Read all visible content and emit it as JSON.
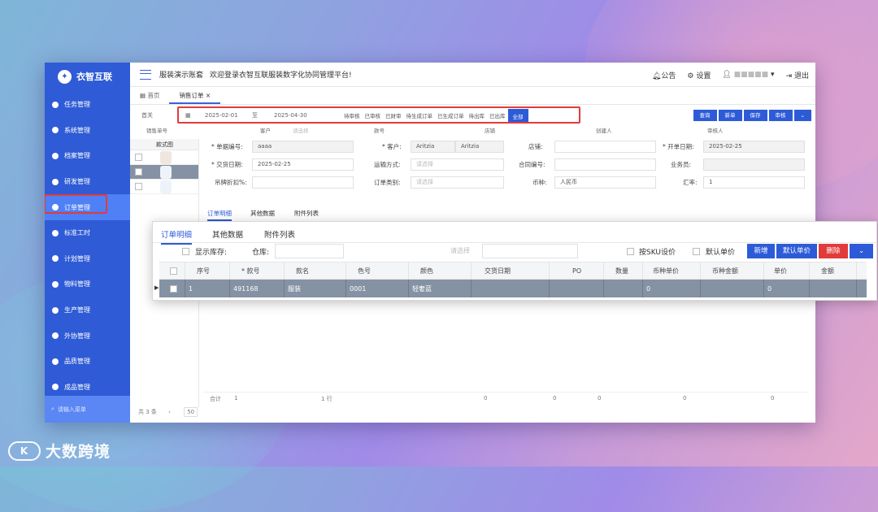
{
  "app": {
    "brand": "衣智互联",
    "company": "服装演示账套",
    "welcome": "欢迎登录衣智互联服装数字化协同管理平台!",
    "notice": "公告",
    "settings": "设置",
    "user": "■■■■■",
    "logout": "退出"
  },
  "sidebar": {
    "items": [
      {
        "label": "任务管理"
      },
      {
        "label": "系统管理"
      },
      {
        "label": "档案管理"
      },
      {
        "label": "研发管理"
      },
      {
        "label": "订单管理"
      },
      {
        "label": "标准工时"
      },
      {
        "label": "计划管理"
      },
      {
        "label": "物料管理"
      },
      {
        "label": "生产管理"
      },
      {
        "label": "外协管理"
      },
      {
        "label": "品质管理"
      },
      {
        "label": "成品管理"
      }
    ],
    "search_placeholder": "请输入菜单"
  },
  "tabs": {
    "home": "首页",
    "sales_order": "销售订单",
    "close": "×"
  },
  "filter": {
    "first": "首关",
    "date_from": "2025-02-01",
    "to": "至",
    "date_to": "2025-04-30",
    "status": [
      "待审核",
      "已审核",
      "已财审",
      "待生成订单",
      "已生成订单",
      "待出库",
      "已出库",
      "全部"
    ],
    "actions": [
      "查询",
      "新单",
      "保存",
      "审核"
    ],
    "row2": [
      "销售单号",
      "客户",
      "请选择",
      "款号",
      "店铺",
      "创建人",
      "审核人"
    ]
  },
  "left_grid": {
    "header": "款式图"
  },
  "form": {
    "order_no_label": "* 单据编号:",
    "order_no": "aaaa",
    "customer_label": "* 客户:",
    "customer_code": "Aritzia",
    "customer_name": "Aritzia",
    "shop_label": "店铺:",
    "open_date_label": "* 开单日期:",
    "open_date": "2025-02-25",
    "delivery_label": "* 交货日期:",
    "delivery_date": "2025-02-25",
    "transport_label": "运输方式:",
    "transport_ph": "请选择",
    "contract_label": "合同编号:",
    "sales_label": "业务员:",
    "discount_label": "吊牌折扣%:",
    "order_type_label": "订单类别:",
    "order_type_ph": "请选择",
    "currency_label": "币种:",
    "currency": "人民币",
    "rate_label": "汇率:",
    "rate": "1"
  },
  "subtabs": [
    "订单明细",
    "其他数据",
    "附件列表"
  ],
  "footer": {
    "total_label": "合计",
    "total_qty": "1",
    "rows": "1 行",
    "zeros": [
      "0",
      "0",
      "0",
      "0",
      "0"
    ],
    "pager": "共 3 条",
    "page_size": "50"
  },
  "overlay": {
    "tabs": [
      "订单明细",
      "其他数据",
      "附件列表"
    ],
    "show_stock": "显示库存:",
    "warehouse": "仓库:",
    "select_ph": "请选择",
    "sku_price": "按SKU设价",
    "default_price": "默认单价",
    "btn_new": "新增",
    "btn_default": "默认单价",
    "btn_delete": "删除",
    "columns": [
      "序号",
      "* 款号",
      "款名",
      "色号",
      "颜色",
      "交货日期",
      "PO",
      "数量",
      "币种单价",
      "币种金额",
      "单价",
      "金额"
    ],
    "row": [
      "1",
      "491168",
      "服装",
      "0001",
      "轻奢蓝",
      "",
      "",
      "",
      "0",
      "",
      "0",
      ""
    ]
  },
  "watermark": "大数跨境",
  "colors": {
    "primary": "#2d5bd8",
    "sidebar": "#2f5bd6",
    "danger": "#e23b3b",
    "row_selected": "#8492a3"
  }
}
